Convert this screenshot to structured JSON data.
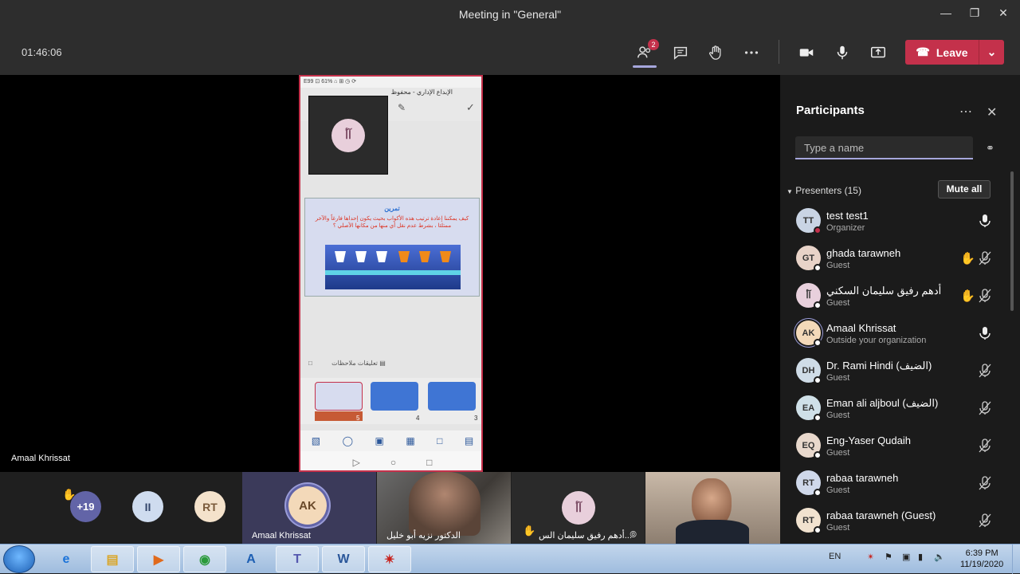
{
  "window": {
    "title": "Meeting in \"General\"",
    "minimize_icon": "minimize-icon",
    "maximize_icon": "maximize-icon",
    "close_icon": "close-icon"
  },
  "controls": {
    "timer": "01:46:06",
    "participants_badge": "2",
    "leave_label": "Leave"
  },
  "shared_screen": {
    "status_bar": "E99 ⊡ 61% ⌂ ⊞ ◷ ⟳",
    "doc_title": "الإبداع الإداري - محفوظ",
    "self_view_initials": "آأ",
    "slide": {
      "title": "تمرين",
      "body": "كيف يمكننا إعادة ترتيب هذه الأكواب بحيث يكون إحداها فارغاً والآخر ممتلئا ، بشرط عدم نقل أي منها من مكانها الأصلي ؟"
    },
    "notes_label": "ملاحظات",
    "comments_label": "تعليقات",
    "thumbnails": [
      {
        "number": "5"
      },
      {
        "number": "4"
      },
      {
        "number": "3"
      }
    ]
  },
  "stage_name": "Amaal Khrissat",
  "strip": {
    "more_count": "+19",
    "tiles": [
      {
        "initials": "II"
      },
      {
        "initials": "RT"
      },
      {
        "initials": "AK",
        "name": "Amaal Khrissat"
      },
      {
        "name": "الدكتور نزيه أبو خليل"
      },
      {
        "initials": "آأ",
        "name": "أدهم رفيق سليمان الس..."
      },
      {
        "name": ""
      }
    ]
  },
  "panel": {
    "title": "Participants",
    "search_placeholder": "Type a name",
    "section_label": "Presenters (15)",
    "mute_all_label": "Mute all",
    "participants": [
      {
        "initials": "TT",
        "name": "test test1",
        "role": "Organizer",
        "hand": false,
        "muted": false,
        "color": "#c9d4e4",
        "status": "#c4314b"
      },
      {
        "initials": "GT",
        "name": "ghada tarawneh",
        "role": "Guest",
        "hand": true,
        "muted": true,
        "color": "#e8d3c8",
        "status": "#ffffff"
      },
      {
        "initials": "آأ",
        "name": "أدهم رفيق سليمان السكني",
        "role": "Guest",
        "hand": true,
        "muted": true,
        "color": "#e8d0dc",
        "status": "#ffffff"
      },
      {
        "initials": "AK",
        "name": "Amaal Khrissat",
        "role": "Outside your organization",
        "hand": false,
        "muted": false,
        "color": "#f3d9b9",
        "status": "#ffffff"
      },
      {
        "initials": "DH",
        "name": "Dr. Rami Hindi (الضيف)",
        "role": "Guest",
        "hand": false,
        "muted": true,
        "color": "#cfdce7",
        "status": "#ffffff"
      },
      {
        "initials": "EA",
        "name": "Eman ali aljboul (الضيف)",
        "role": "Guest",
        "hand": false,
        "muted": true,
        "color": "#cfe0e8",
        "status": "#ffffff"
      },
      {
        "initials": "EQ",
        "name": "Eng-Yaser Qudaih",
        "role": "Guest",
        "hand": false,
        "muted": true,
        "color": "#e8d8cc",
        "status": "#ffffff"
      },
      {
        "initials": "RT",
        "name": "rabaa tarawneh",
        "role": "Guest",
        "hand": false,
        "muted": true,
        "color": "#cfd8ea",
        "status": "#ffffff"
      },
      {
        "initials": "RT",
        "name": "rabaa tarawneh (Guest)",
        "role": "Guest",
        "hand": false,
        "muted": true,
        "color": "#f1e2cf",
        "status": "#ffffff"
      }
    ]
  },
  "taskbar": {
    "language": "EN",
    "time": "6:39 PM",
    "date": "11/19/2020",
    "apps": [
      "ie-icon",
      "explorer-icon",
      "media-player-icon",
      "chrome-icon",
      "app-a-icon",
      "teams-icon",
      "word-icon",
      "acrobat-icon"
    ]
  }
}
